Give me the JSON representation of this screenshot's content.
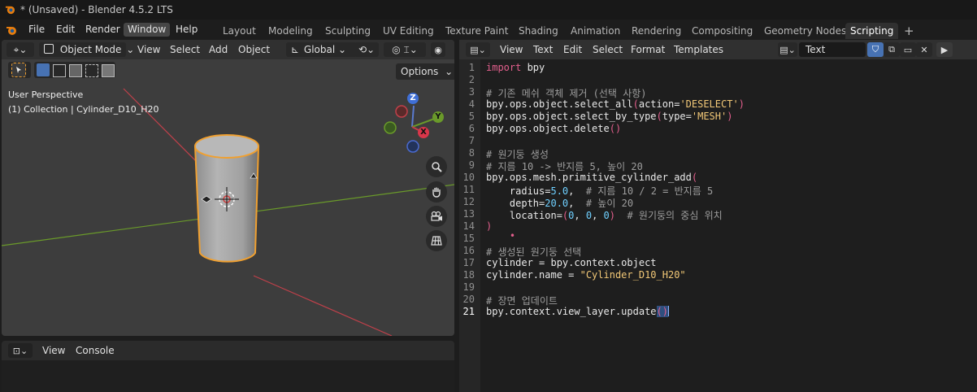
{
  "titlebar": {
    "title": "* (Unsaved) - Blender 4.5.2 LTS"
  },
  "menubar": {
    "menus": [
      "File",
      "Edit",
      "Render",
      "Window",
      "Help"
    ],
    "active_menu": "Window",
    "workspaces": [
      "Layout",
      "Modeling",
      "Sculpting",
      "UV Editing",
      "Texture Paint",
      "Shading",
      "Animation",
      "Rendering",
      "Compositing",
      "Geometry Nodes",
      "Scripting"
    ],
    "active_workspace": "Scripting",
    "add_workspace": "+"
  },
  "viewport": {
    "mode": "Object Mode",
    "menus": [
      "View",
      "Select",
      "Add",
      "Object"
    ],
    "orientation": "Global",
    "options_label": "Options",
    "perspective_label": "User Perspective",
    "collection_label": "(1) Collection | Cylinder_D10_H20",
    "gizmo_axes": [
      "Z",
      "Y",
      "X"
    ],
    "colors": {
      "background": "#3d3d3d",
      "selection_outline": "#f0a030",
      "x_axis": "#c0404a",
      "y_axis": "#6a9a2a"
    },
    "icons": [
      "editor-type-icon",
      "object-mode-icon",
      "select-box-icon",
      "transform-orientation-icon",
      "pivot-icon",
      "snap-icon",
      "proportional-icon",
      "magnify-icon",
      "hand-icon",
      "camera-icon",
      "grid-icon"
    ]
  },
  "console": {
    "menus": [
      "View",
      "Console"
    ]
  },
  "editor": {
    "menus": [
      "View",
      "Text",
      "Edit",
      "Select",
      "Format",
      "Templates"
    ],
    "text_name": "Text",
    "current_line": 21,
    "line_numbers": [
      "1",
      "2",
      "3",
      "4",
      "5",
      "6",
      "7",
      "8",
      "9",
      "10",
      "11",
      "12",
      "13",
      "14",
      "15",
      "16",
      "17",
      "18",
      "19",
      "20",
      "21"
    ],
    "lines": {
      "l1": {
        "kw": "import",
        "rest": " bpy"
      },
      "l3": "# 기존 메쉬 객체 제거 (선택 사항)",
      "l4": {
        "a": "bpy.ops.object.select_all",
        "p1": "(",
        "b": "action=",
        "s": "'DESELECT'",
        "p2": ")"
      },
      "l5": {
        "a": "bpy.ops.object.select_by_type",
        "p1": "(",
        "b": "type=",
        "s": "'MESH'",
        "p2": ")"
      },
      "l6": {
        "a": "bpy.ops.object.delete",
        "p": "()"
      },
      "l8": "# 원기둥 생성",
      "l9": "# 지름 10 -> 반지름 5, 높이 20",
      "l10": {
        "a": "bpy.ops.mesh.primitive_cylinder_add",
        "p": "("
      },
      "l11": {
        "a": "    radius=",
        "n": "5.0",
        "b": ",  ",
        "c": "# 지름 10 / 2 = 반지름 5"
      },
      "l12": {
        "a": "    depth=",
        "n": "20.0",
        "b": ",  ",
        "c": "# 높이 20"
      },
      "l13": {
        "a": "    location=",
        "p1": "(",
        "n1": "0",
        "b1": ", ",
        "n2": "0",
        "b2": ", ",
        "n3": "0",
        "p2": ")",
        "b3": "  ",
        "c": "# 원기둥의 중심 위치"
      },
      "l14": ")",
      "l15": "    •",
      "l16": "# 생성된 원기둥 선택",
      "l17": "cylinder = bpy.context.object",
      "l18": {
        "a": "cylinder.name = ",
        "s": "\"Cylinder_D10_H20\""
      },
      "l20": "# 장면 업데이트",
      "l21": {
        "a": "bpy.context.view_layer.update",
        "p": "()"
      }
    }
  }
}
